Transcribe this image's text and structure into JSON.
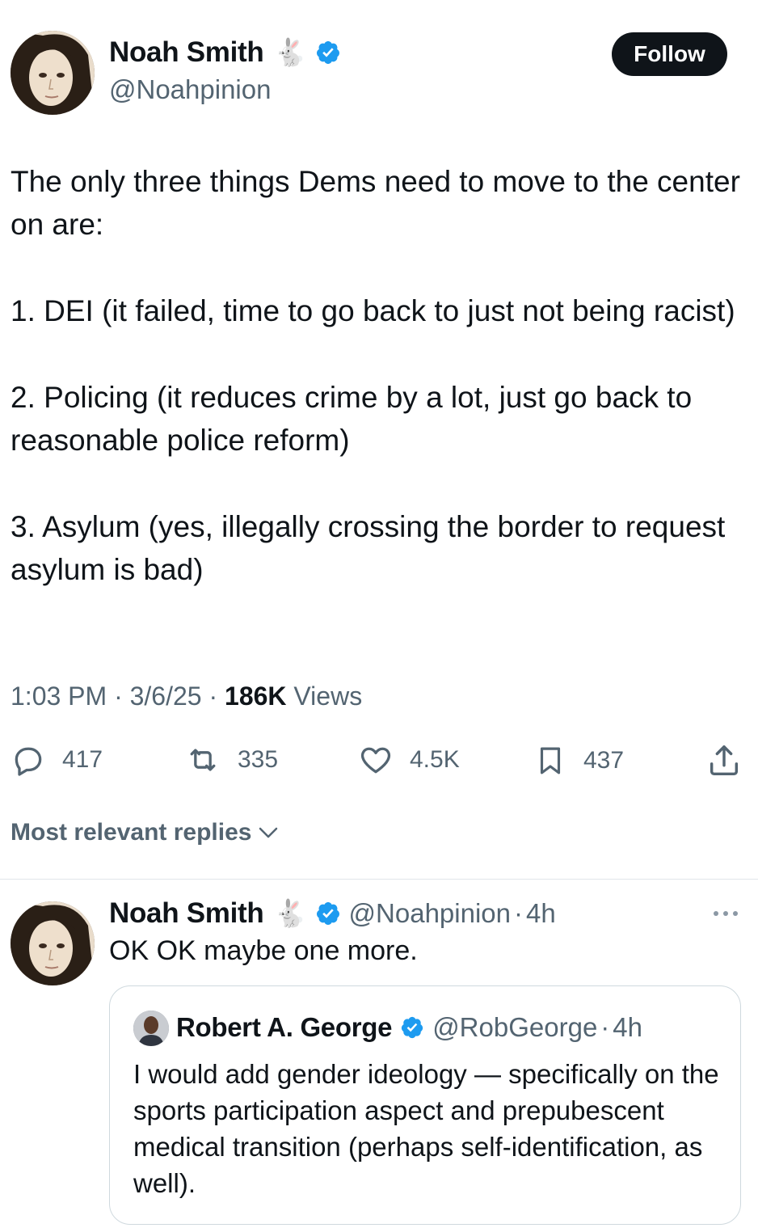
{
  "tweet": {
    "author_name": "Noah Smith",
    "author_emoji": "🐇",
    "author_handle": "@Noahpinion",
    "follow_label": "Follow",
    "paragraphs": [
      "The only three things Dems need to move to the center on are:",
      "1. DEI (it failed, time to go back to just not being racist)",
      "2. Policing (it reduces crime by a lot, just go back to reasonable police reform)",
      "3. Asylum (yes, illegally crossing the border to request asylum is bad)"
    ],
    "time": "1:03 PM",
    "date": "3/6/25",
    "views_count": "186K",
    "views_label": "Views",
    "separator": "·",
    "actions": {
      "replies": "417",
      "reposts": "335",
      "likes": "4.5K",
      "bookmarks": "437"
    }
  },
  "replies_filter": {
    "label": "Most relevant replies"
  },
  "reply": {
    "author_name": "Noah Smith",
    "author_emoji": "🐇",
    "author_handle": "@Noahpinion",
    "age": "4h",
    "text": "OK OK maybe one more.",
    "quote": {
      "author_name": "Robert A. George",
      "author_handle": "@RobGeorge",
      "age": "4h",
      "text": "I would add gender ideology — specifically on the sports participation aspect and prepubescent medical transition (perhaps self-identification, as well)."
    }
  },
  "colors": {
    "verified_blue": "#1d9bf0",
    "text_primary": "#0f1419",
    "text_secondary": "#536471",
    "follow_bg": "#0f1419"
  }
}
